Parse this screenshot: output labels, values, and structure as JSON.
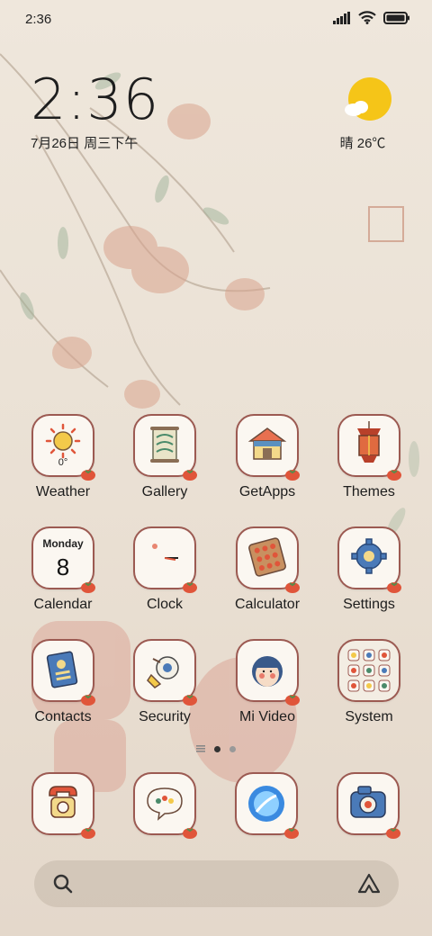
{
  "status": {
    "time": "2:36"
  },
  "clock_widget": {
    "time": "2:36",
    "date": "7月26日 周三下午"
  },
  "weather_widget": {
    "label": "晴 26℃"
  },
  "apps": [
    {
      "label": "Weather",
      "badge": "0°"
    },
    {
      "label": "Gallery"
    },
    {
      "label": "GetApps"
    },
    {
      "label": "Themes"
    },
    {
      "label": "Calendar",
      "day": "Monday",
      "date": "8"
    },
    {
      "label": "Clock"
    },
    {
      "label": "Calculator"
    },
    {
      "label": "Settings"
    },
    {
      "label": "Contacts"
    },
    {
      "label": "Security"
    },
    {
      "label": "Mi Video"
    },
    {
      "label": "System"
    }
  ],
  "dock": [
    {
      "icon": "phone-icon"
    },
    {
      "icon": "messages-icon"
    },
    {
      "icon": "browser-icon"
    },
    {
      "icon": "camera-icon"
    }
  ],
  "pager": {
    "pages": 2,
    "current": 1
  },
  "colors": {
    "icon_border": "#9c5a52",
    "icon_bg": "#fbf7f1",
    "tomato": "#e0553a"
  }
}
